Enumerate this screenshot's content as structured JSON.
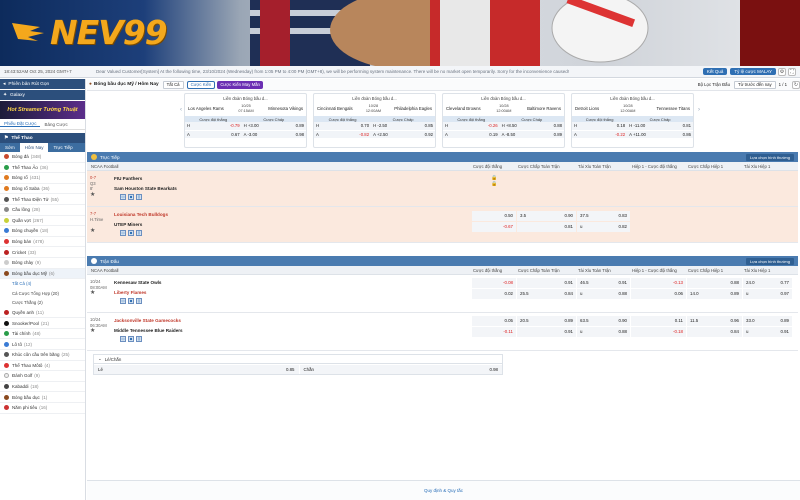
{
  "brand": {
    "name": "NEV99",
    "accent": "#f4a81c"
  },
  "topbar": {
    "time": "18:43:52AM Oct 25, 2024 GMT+7",
    "announcement": "Dear Valued Customer[System] At the following time, 23/10/2024 (Wednesday) from 1:05 PM to 4:00 PM (GMT+8), we will be performing system maintenance. There will be no market open temporarily. Sorry for the inconvenience caused!",
    "result_label": "Kết Quả",
    "odds_label": "Tỷ lệ cược MALAY"
  },
  "sidebar": {
    "old_version": "Phiên bản Rút Gọn",
    "galaxy": "Galaxy",
    "banner": "Hot Streamer Tường Thuật",
    "tabs": [
      "Phiếu Đặt Cược",
      "Bảng Cược"
    ],
    "section": "Thể Thao",
    "sub_tabs": [
      "Sớm",
      "Hôm Nay",
      "Trực Tiếp"
    ],
    "items": [
      {
        "label": "Bóng đá",
        "count": "(348)"
      },
      {
        "label": "Thể Thao Ảo",
        "count": "(36)"
      },
      {
        "label": "Bóng rổ",
        "count": "(431)"
      },
      {
        "label": "Bóng rổ Saba",
        "count": "(36)"
      },
      {
        "label": "Thể Thao Điện Tử",
        "count": "(55)"
      },
      {
        "label": "Cầu lông",
        "count": "(28)"
      },
      {
        "label": "Quần vợt",
        "count": "(267)"
      },
      {
        "label": "Bóng chuyền",
        "count": "(18)"
      },
      {
        "label": "Bóng bàn",
        "count": "(478)"
      },
      {
        "label": "Cricket",
        "count": "(33)"
      },
      {
        "label": "Bóng chày",
        "count": "(9)"
      },
      {
        "label": "Bóng bầu dục Mỹ",
        "count": "(6)"
      }
    ],
    "sublist": [
      "Tất Cả (4)",
      "Cá Cược Tổng Hợp (20)",
      "Cược Thắng (2)"
    ],
    "items2": [
      {
        "label": "Quyền anh",
        "count": "(11)"
      },
      {
        "label": "Snooker/Pool",
        "count": "(21)"
      },
      {
        "label": "Tài chính",
        "count": "(48)"
      },
      {
        "label": "Lô tô",
        "count": "(12)"
      },
      {
        "label": "Khúc côn cầu trên băng",
        "count": "(25)"
      },
      {
        "label": "Thể Thao Môtô",
        "count": "(4)"
      },
      {
        "label": "Đánh Golf",
        "count": "(9)"
      },
      {
        "label": "Kabaddi",
        "count": "(18)"
      },
      {
        "label": "Bóng bầu dục",
        "count": "(1)"
      },
      {
        "label": "Năm phi tiêu",
        "count": "(16)"
      }
    ]
  },
  "filter": {
    "title": "Bóng bầu dục Mỹ / Hôm Nay",
    "select": "Tất Cả",
    "tab1": "Cược Kiến",
    "tab2": "Cược Kiến May Mắn",
    "right1": "Bộ Lọc Trận Đấu",
    "right2": "Từ trước đến nay",
    "page": "1 / 1"
  },
  "cards": [
    {
      "league": "Liên đoàn Bóng bầu d...",
      "home": "Los Angeles Rams",
      "away": "Minnesota Vikings",
      "date": "10/25",
      "time": "07:15AM",
      "h1": "Cược đội thắng",
      "h2": "Cược Chấp",
      "rows": [
        [
          "H",
          "-0.79",
          "H +3.00",
          "0.89"
        ],
        [
          "A",
          "0.67",
          "A -3.00",
          "0.98"
        ]
      ]
    },
    {
      "league": "Liên đoàn Bóng bầu d...",
      "home": "Cincinnati Bengals",
      "away": "Philadelphia Eagles",
      "date": "10/28",
      "time": "12:00AM",
      "h1": "Cược đội thắng",
      "h2": "Cược Chấp",
      "rows": [
        [
          "H",
          "0.70",
          "H -2.50",
          "0.85"
        ],
        [
          "A",
          "-0.82",
          "A +2.50",
          "0.92"
        ]
      ]
    },
    {
      "league": "Liên đoàn Bóng bầu d...",
      "home": "Cleveland Browns",
      "away": "Baltimore Ravens",
      "date": "10/28",
      "time": "12:00AM",
      "h1": "Cược đội thắng",
      "h2": "Cược Chấp",
      "rows": [
        [
          "H",
          "-0.26",
          "H +8.50",
          "0.88"
        ],
        [
          "A",
          "0.19",
          "A -8.50",
          "0.89"
        ]
      ]
    },
    {
      "league": "Liên đoàn Bóng bầu d...",
      "home": "Detroit Lions",
      "away": "Tennessee Titans",
      "date": "10/28",
      "time": "12:00AM",
      "h1": "Cược đội thắng",
      "h2": "Cược Chấp",
      "rows": [
        [
          "H",
          "0.18",
          "H -11.00",
          "0.81"
        ],
        [
          "A",
          "-0.22",
          "A +11.00",
          "0.86"
        ]
      ]
    }
  ],
  "live": {
    "section": "Trực Tiếp",
    "right": "Lựa chọn hình thường",
    "league": "NCAA Football",
    "headers": [
      "Cược đội thắng",
      "Cược Chấp Toàn Trận",
      "Tài Xỉu Toàn Trận",
      "Hiệp 1 - Cược đội thắng",
      "Cược Chấp Hiệp 1",
      "Tài Xỉu Hiệp 1"
    ],
    "matches": [
      {
        "score": "0-7",
        "period": "Q3",
        "clock": "8'",
        "home": "FIU Panthers",
        "away": "Sam Houston State Bearkats",
        "highlight": "home",
        "lines": [
          [
            "",
            "",
            "",
            "",
            "",
            ""
          ],
          [
            "",
            "",
            "",
            "",
            "",
            ""
          ]
        ]
      },
      {
        "score": "7-7",
        "period": "H.Time",
        "clock": "",
        "home": "Louisiana Tech Bulldogs",
        "away": "UTEP Miners",
        "highlight": "home",
        "lines": [
          [
            "0.50",
            "3.5",
            "0.90",
            "37.5",
            "0.83"
          ],
          [
            "-0.67",
            "",
            "0.81",
            "u",
            "0.82"
          ]
        ]
      }
    ]
  },
  "early": {
    "section": "Trận Đấu",
    "right": "Lựa chọn hình thường",
    "league": "NCAA Football",
    "headers": [
      "Cược đội thắng",
      "Cược Chấp Toàn Trận",
      "Tài Xỉu Toàn Trận",
      "Hiệp 1 - Cược đội thắng",
      "Cược Chấp Hiệp 1",
      "Tài Xỉu Hiệp 1"
    ],
    "matches": [
      {
        "date": "10/24",
        "time": "08:00AM",
        "home": "Kennesaw State Owls",
        "away": "Liberty Flames",
        "highlight": "away",
        "l1": [
          "-0.08",
          "",
          "0.91",
          "46.5",
          "0.91",
          "-0.13",
          "",
          "0.88",
          "24.0",
          "0.77"
        ],
        "l2": [
          "0.02",
          "25.5",
          "0.84",
          "u",
          "0.88",
          "0.06",
          "14.0",
          "0.89",
          "u",
          "0.97"
        ]
      },
      {
        "date": "10/24",
        "time": "06:30AM",
        "home": "Jacksonville State Gamecocks",
        "away": "Middle Tennessee Blue Raiders",
        "highlight": "home",
        "l1": [
          "0.05",
          "20.5",
          "0.89",
          "63.5",
          "0.90",
          "0.11",
          "11.5",
          "0.96",
          "33.0",
          "0.89"
        ],
        "l2": [
          "-0.11",
          "",
          "0.91",
          "u",
          "0.88",
          "-0.18",
          "",
          "0.84",
          "u",
          "0.91"
        ]
      }
    ]
  },
  "odd_even": {
    "title": "Lẻ/Chẵn",
    "odd_label": "Lẻ",
    "odd_value": "0.85",
    "even_label": "Chẵn",
    "even_value": "0.98"
  },
  "footer": {
    "text": "Quy định & Quy tắc"
  }
}
